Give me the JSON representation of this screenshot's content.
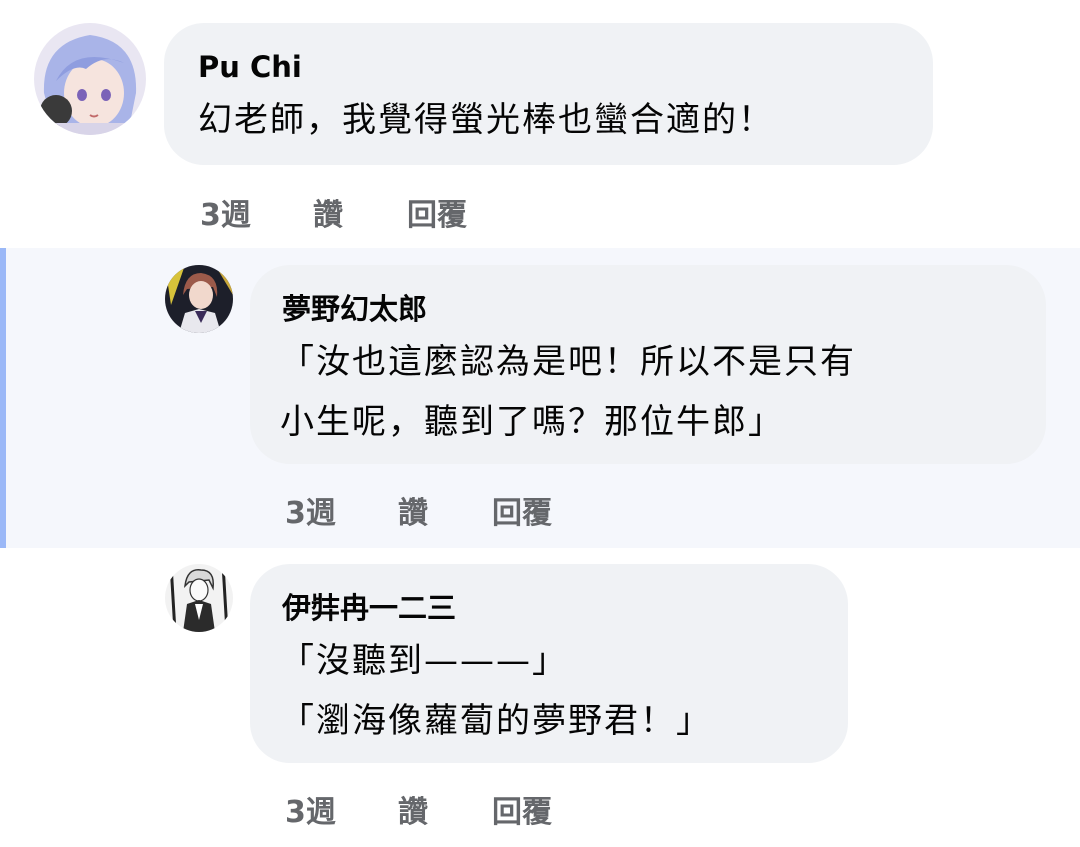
{
  "comments": [
    {
      "author": "Pu Chi",
      "lines": [
        "幻老師，我覺得螢光棒也蠻合適的！"
      ],
      "time": "3週",
      "like_label": "讚",
      "reply_label": "回覆",
      "avatar_icon": "avatar-lavender-hair-character"
    },
    {
      "author": "夢野幻太郎",
      "lines": [
        "「汝也這麼認為是吧！所以不是只有",
        "小生呢，聽到了嗎？那位牛郎」"
      ],
      "time": "3週",
      "like_label": "讚",
      "reply_label": "回覆",
      "avatar_icon": "avatar-anime-character"
    },
    {
      "author": "伊弉冉一二三",
      "lines": [
        "「沒聽到———」",
        "「瀏海像蘿蔔的夢野君！」"
      ],
      "time": "3週",
      "like_label": "讚",
      "reply_label": "回覆",
      "avatar_icon": "avatar-monochrome-character"
    }
  ],
  "colors": {
    "bubble": "#f0f2f5",
    "highlight_bg": "#f5f7fc",
    "highlight_bar": "#9bb8f7",
    "action_text": "#65676b"
  }
}
